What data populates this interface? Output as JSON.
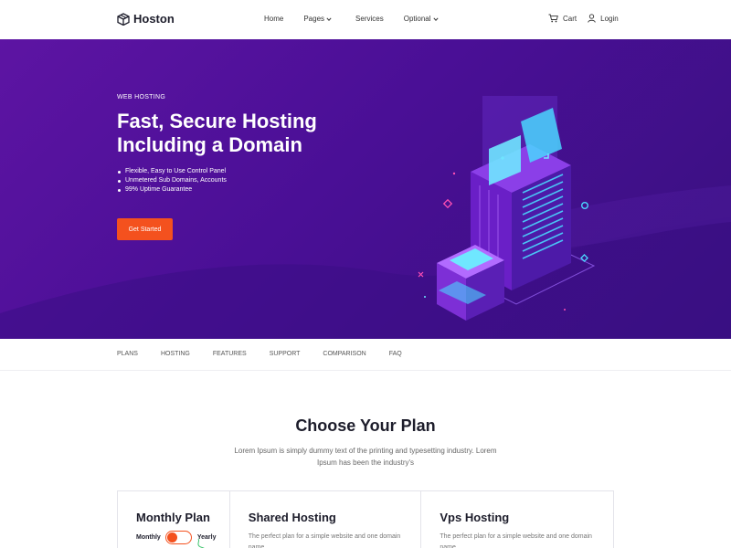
{
  "brand": {
    "name": "Hoston",
    "logo_icon": "cube-icon"
  },
  "nav": {
    "items": [
      {
        "label": "Home",
        "dropdown": false
      },
      {
        "label": "Pages",
        "dropdown": true
      },
      {
        "label": "Services",
        "dropdown": false
      },
      {
        "label": "Optional",
        "dropdown": true
      }
    ],
    "cart": {
      "label": "Cart",
      "icon": "cart-icon"
    },
    "login": {
      "label": "Login",
      "icon": "user-icon"
    }
  },
  "hero": {
    "eyebrow": "WEB HOSTING",
    "title": "Fast, Secure Hosting Including a Domain",
    "features": [
      "Flexible, Easy to Use Control Panel",
      "Unmetered Sub Domains, Accounts",
      "99% Uptime Guarantee"
    ],
    "cta": "Get Started",
    "colors": {
      "background": "#4a0f96",
      "accent": "#f4511e",
      "illustration": "#7b2fd6"
    }
  },
  "subnav": {
    "items": [
      "PLANS",
      "HOSTING",
      "FEATURES",
      "SUPPORT",
      "COMPARISON",
      "FAQ"
    ]
  },
  "plans": {
    "title": "Choose Your Plan",
    "subtitle": "Lorem Ipsum is simply dummy text of the printing and typesetting industry. Lorem Ipsum has been the industry's",
    "toggle_card": {
      "title": "Monthly Plan",
      "monthly_label": "Monthly",
      "yearly_label": "Yearly"
    },
    "cards": [
      {
        "title": "Shared Hosting",
        "description": "The perfect plan for a simple website and one domain name."
      },
      {
        "title": "Vps Hosting",
        "description": "The perfect plan for a simple website and one domain name."
      }
    ]
  }
}
